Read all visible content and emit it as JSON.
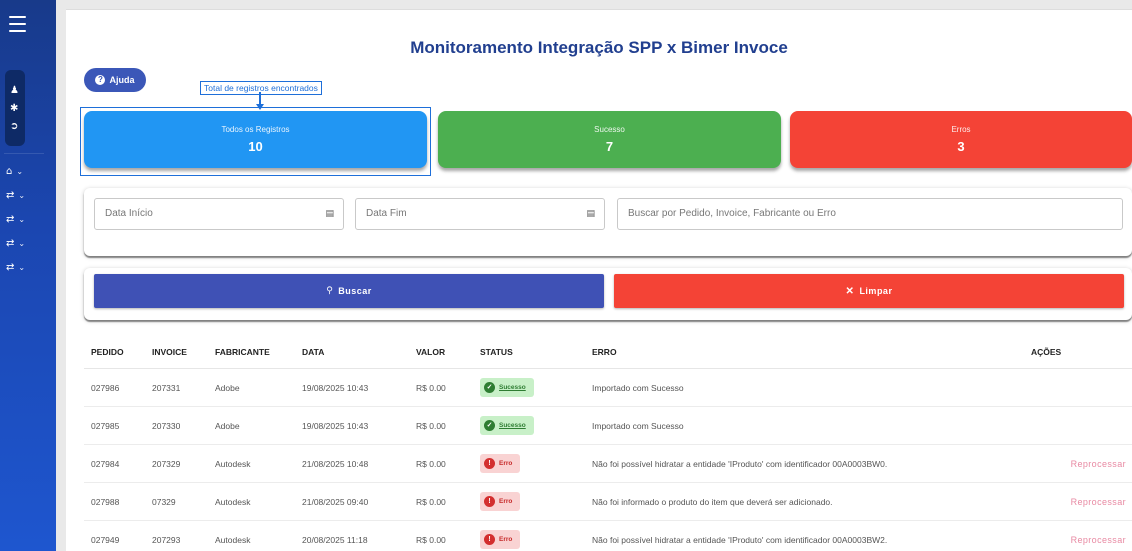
{
  "sidebar": {
    "icons": [
      "menu-icon",
      "user-icon",
      "gear-icon",
      "logout-icon"
    ],
    "nav": [
      {
        "icon": "home-icon",
        "glyph": "⌂"
      },
      {
        "icon": "exchange-icon",
        "glyph": "⇄"
      },
      {
        "icon": "exchange-icon",
        "glyph": "⇄"
      },
      {
        "icon": "exchange-icon",
        "glyph": "⇄"
      },
      {
        "icon": "exchange-icon",
        "glyph": "⇄"
      }
    ]
  },
  "page": {
    "title": "Monitoramento Integração SPP x Bimer Invoce",
    "help_label": "Ajuda",
    "tooltip": "Total de registros encontrados"
  },
  "cards": {
    "all": {
      "label": "Todos os Registros",
      "value": "10"
    },
    "success": {
      "label": "Sucesso",
      "value": "7"
    },
    "errors": {
      "label": "Erros",
      "value": "3"
    }
  },
  "filters": {
    "start_placeholder": "Data Início",
    "end_placeholder": "Data Fim",
    "search_placeholder": "Buscar por Pedido, Invoice, Fabricante ou Erro"
  },
  "buttons": {
    "search": "Buscar",
    "clear": "Limpar"
  },
  "table": {
    "headers": {
      "pedido": "PEDIDO",
      "invoice": "INVOICE",
      "fabricante": "FABRICANTE",
      "data": "DATA",
      "valor": "VALOR",
      "status": "STATUS",
      "erro": "ERRO",
      "acoes": "AÇÕES"
    },
    "rows": [
      {
        "pedido": "027986",
        "invoice": "207331",
        "fabricante": "Adobe",
        "data": "19/08/2025 10:43",
        "valor": "R$ 0.00",
        "status": "Sucesso",
        "erro": "Importado com Sucesso",
        "acao": ""
      },
      {
        "pedido": "027985",
        "invoice": "207330",
        "fabricante": "Adobe",
        "data": "19/08/2025 10:43",
        "valor": "R$ 0.00",
        "status": "Sucesso",
        "erro": "Importado com Sucesso",
        "acao": ""
      },
      {
        "pedido": "027984",
        "invoice": "207329",
        "fabricante": "Autodesk",
        "data": "21/08/2025 10:48",
        "valor": "R$ 0.00",
        "status": "Erro",
        "erro": "Não foi possível hidratar a entidade 'IProduto' com identificador 00A0003BW0.",
        "acao": "Reprocessar"
      },
      {
        "pedido": "027988",
        "invoice": "07329",
        "fabricante": "Autodesk",
        "data": "21/08/2025 09:40",
        "valor": "R$ 0.00",
        "status": "Erro",
        "erro": "Não foi informado o produto do item que deverá ser adicionado.",
        "acao": "Reprocessar"
      },
      {
        "pedido": "027949",
        "invoice": "207293",
        "fabricante": "Autodesk",
        "data": "20/08/2025 11:18",
        "valor": "R$ 0.00",
        "status": "Erro",
        "erro": "Não foi possível hidratar a entidade 'IProduto' com identificador 00A0003BW2.",
        "acao": "Reprocessar"
      }
    ]
  }
}
